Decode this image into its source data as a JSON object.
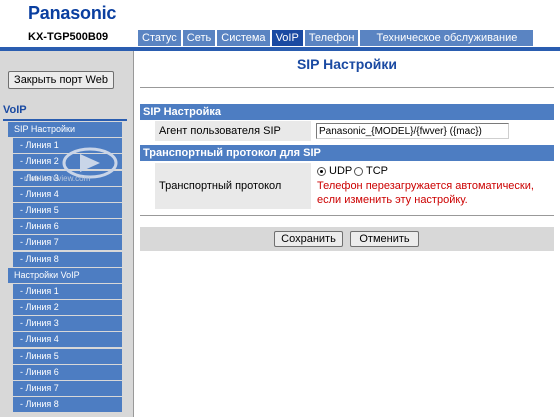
{
  "header": {
    "logo": "Panasonic",
    "model": "KX-TGP500B09",
    "tabs": [
      {
        "label": "Статус"
      },
      {
        "label": "Сеть"
      },
      {
        "label": "Система"
      },
      {
        "label": "VoIP"
      },
      {
        "label": "Телефон"
      },
      {
        "label": "Техническое обслуживание"
      }
    ],
    "active_tab": "VoIP"
  },
  "sidebar": {
    "close_port_label": "Закрыть порт Web",
    "section_label": "VoIP",
    "menu": [
      {
        "label": "SIP Настройки"
      },
      {
        "label": "- Линия 1"
      },
      {
        "label": "- Линия 2"
      },
      {
        "label": "- Линия 3"
      },
      {
        "label": "- Линия 4"
      },
      {
        "label": "- Линия 5"
      },
      {
        "label": "- Линия 6"
      },
      {
        "label": "- Линия 7"
      },
      {
        "label": "- Линия 8"
      },
      {
        "label": "Настройки VoIP"
      },
      {
        "label": "- Линия 1"
      },
      {
        "label": "- Линия 2"
      },
      {
        "label": "- Линия 3"
      },
      {
        "label": "- Линия 4"
      },
      {
        "label": "- Линия 5"
      },
      {
        "label": "- Линия 6"
      },
      {
        "label": "- Линия 7"
      },
      {
        "label": "- Линия 8"
      }
    ]
  },
  "main": {
    "title": "SIP Настройки",
    "section1_title": "SIP Настройка",
    "user_agent_label": "Агент пользователя SIP",
    "user_agent_value": "Panasonic_{MODEL}/{fwver} ({mac})",
    "section2_title": "Транспортный протокол для SIP",
    "transport_label": "Транспортный протокол",
    "transport_options": [
      {
        "label": "UDP",
        "checked": true
      },
      {
        "label": "TCP",
        "checked": false
      }
    ],
    "warning": "Телефон перезагружается автоматически, если изменить эту настройку.",
    "save_label": "Сохранить",
    "cancel_label": "Отменить"
  },
  "watermark": {
    "text": "mobile-review.com"
  },
  "colors": {
    "brand": "#0a3fa0",
    "tab": "#5a84c2",
    "tab_active": "#1a4aa2",
    "section": "#4d7dc2",
    "warning": "#cc0000",
    "sidebar_bg": "#d8d8d8"
  }
}
